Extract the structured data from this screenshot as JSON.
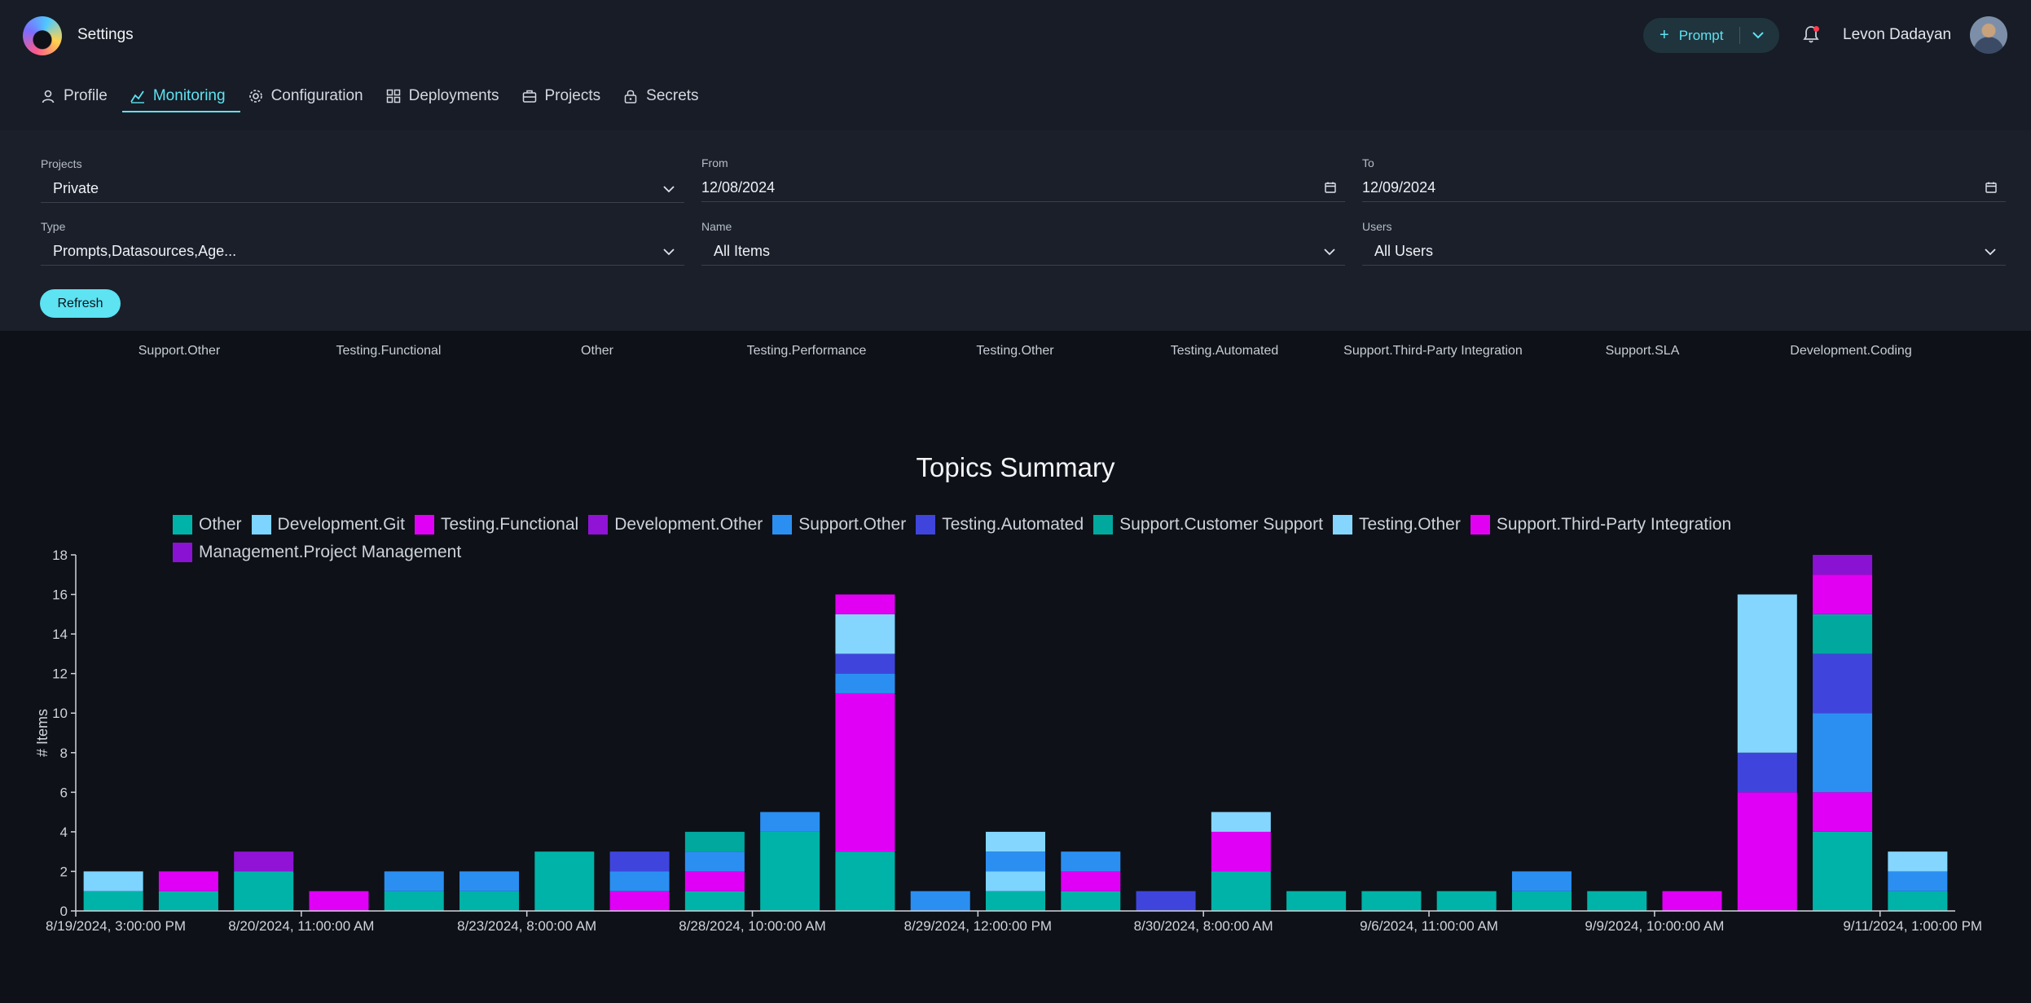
{
  "header": {
    "title": "Settings",
    "prompt_label": "Prompt",
    "user_name": "Levon Dadayan"
  },
  "tabs": [
    {
      "label": "Profile",
      "icon": "user-icon",
      "active": false
    },
    {
      "label": "Monitoring",
      "icon": "monitoring-icon",
      "active": true
    },
    {
      "label": "Configuration",
      "icon": "gear-icon",
      "active": false
    },
    {
      "label": "Deployments",
      "icon": "grid-icon",
      "active": false
    },
    {
      "label": "Projects",
      "icon": "briefcase-icon",
      "active": false
    },
    {
      "label": "Secrets",
      "icon": "lock-icon",
      "active": false
    }
  ],
  "filters": {
    "projects": {
      "label": "Projects",
      "value": "Private"
    },
    "from": {
      "label": "From",
      "value": "12/08/2024"
    },
    "to": {
      "label": "To",
      "value": "12/09/2024"
    },
    "type": {
      "label": "Type",
      "value": "Prompts,Datasources,Age..."
    },
    "name": {
      "label": "Name",
      "value": "All Items"
    },
    "users": {
      "label": "Users",
      "value": "All Users"
    },
    "refresh_label": "Refresh"
  },
  "topics_row": [
    "Support.Other",
    "Testing.Functional",
    "Other",
    "Testing.Performance",
    "Testing.Other",
    "Testing.Automated",
    "Support.Third-Party Integration",
    "Support.SLA",
    "Development.Coding"
  ],
  "colors": {
    "accent": "#5de3f2",
    "background": "#0e1117",
    "panel": "#1a1f2a"
  },
  "chart_data": {
    "type": "bar",
    "stacked": true,
    "title": "Topics Summary",
    "ylabel": "# Items",
    "xlabel": "",
    "ylim": [
      0,
      18
    ],
    "yticks": [
      0,
      2,
      4,
      6,
      8,
      10,
      12,
      14,
      16,
      18
    ],
    "xtick_labels": [
      "8/19/2024, 3:00:00 PM",
      "8/20/2024, 11:00:00 AM",
      "8/23/2024, 8:00:00 AM",
      "8/28/2024, 10:00:00 AM",
      "8/29/2024, 12:00:00 PM",
      "8/30/2024, 8:00:00 AM",
      "9/6/2024, 11:00:00 AM",
      "9/9/2024, 10:00:00 AM",
      "9/11/2024, 1:00:00 PM"
    ],
    "legend_placement": "top",
    "grid": false,
    "series": [
      {
        "name": "Other",
        "color": "#00b3a8",
        "values": [
          1,
          1,
          2,
          0,
          1,
          1,
          3,
          0,
          1,
          4,
          3,
          0,
          1,
          1,
          0,
          2,
          1,
          1,
          1,
          1,
          1,
          0,
          0,
          4,
          1
        ]
      },
      {
        "name": "Development.Git",
        "color": "#7cd4ff",
        "values": [
          1,
          0,
          0,
          0,
          0,
          0,
          0,
          0,
          0,
          0,
          0,
          0,
          1,
          0,
          0,
          0,
          0,
          0,
          0,
          0,
          0,
          0,
          0,
          0,
          0
        ]
      },
      {
        "name": "Testing.Functional",
        "color": "#df00f5",
        "values": [
          0,
          1,
          0,
          1,
          0,
          0,
          0,
          1,
          1,
          0,
          8,
          0,
          0,
          1,
          0,
          2,
          0,
          0,
          0,
          0,
          0,
          1,
          6,
          2,
          0
        ]
      },
      {
        "name": "Development.Other",
        "color": "#9013d6",
        "values": [
          0,
          0,
          1,
          0,
          0,
          0,
          0,
          0,
          0,
          0,
          0,
          0,
          0,
          0,
          0,
          0,
          0,
          0,
          0,
          0,
          0,
          0,
          0,
          0,
          0
        ]
      },
      {
        "name": "Support.Other",
        "color": "#2b8ff2",
        "values": [
          0,
          0,
          0,
          0,
          1,
          1,
          0,
          1,
          1,
          1,
          1,
          1,
          1,
          1,
          0,
          0,
          0,
          0,
          0,
          1,
          0,
          0,
          0,
          4,
          1
        ]
      },
      {
        "name": "Testing.Automated",
        "color": "#3f45dc",
        "values": [
          0,
          0,
          0,
          0,
          0,
          0,
          0,
          1,
          0,
          0,
          1,
          0,
          0,
          0,
          1,
          0,
          0,
          0,
          0,
          0,
          0,
          0,
          2,
          3,
          0
        ]
      },
      {
        "name": "Support.Customer Support",
        "color": "#00a89e",
        "values": [
          0,
          0,
          0,
          0,
          0,
          0,
          0,
          0,
          1,
          0,
          0,
          0,
          0,
          0,
          0,
          0,
          0,
          0,
          0,
          0,
          0,
          0,
          0,
          2,
          0
        ]
      },
      {
        "name": "Testing.Other",
        "color": "#84d6ff",
        "values": [
          0,
          0,
          0,
          0,
          0,
          0,
          0,
          0,
          0,
          0,
          2,
          0,
          1,
          0,
          0,
          1,
          0,
          0,
          0,
          0,
          0,
          0,
          8,
          0,
          1
        ]
      },
      {
        "name": "Support.Third-Party Integration",
        "color": "#e100f2",
        "values": [
          0,
          0,
          0,
          0,
          0,
          0,
          0,
          0,
          0,
          0,
          1,
          0,
          0,
          0,
          0,
          0,
          0,
          0,
          0,
          0,
          0,
          0,
          0,
          2,
          0
        ]
      },
      {
        "name": "Management.Project Management",
        "color": "#8a12d2",
        "values": [
          0,
          0,
          0,
          0,
          0,
          0,
          0,
          0,
          0,
          0,
          0,
          0,
          0,
          0,
          0,
          0,
          0,
          0,
          0,
          0,
          0,
          0,
          0,
          1,
          0
        ]
      }
    ]
  }
}
